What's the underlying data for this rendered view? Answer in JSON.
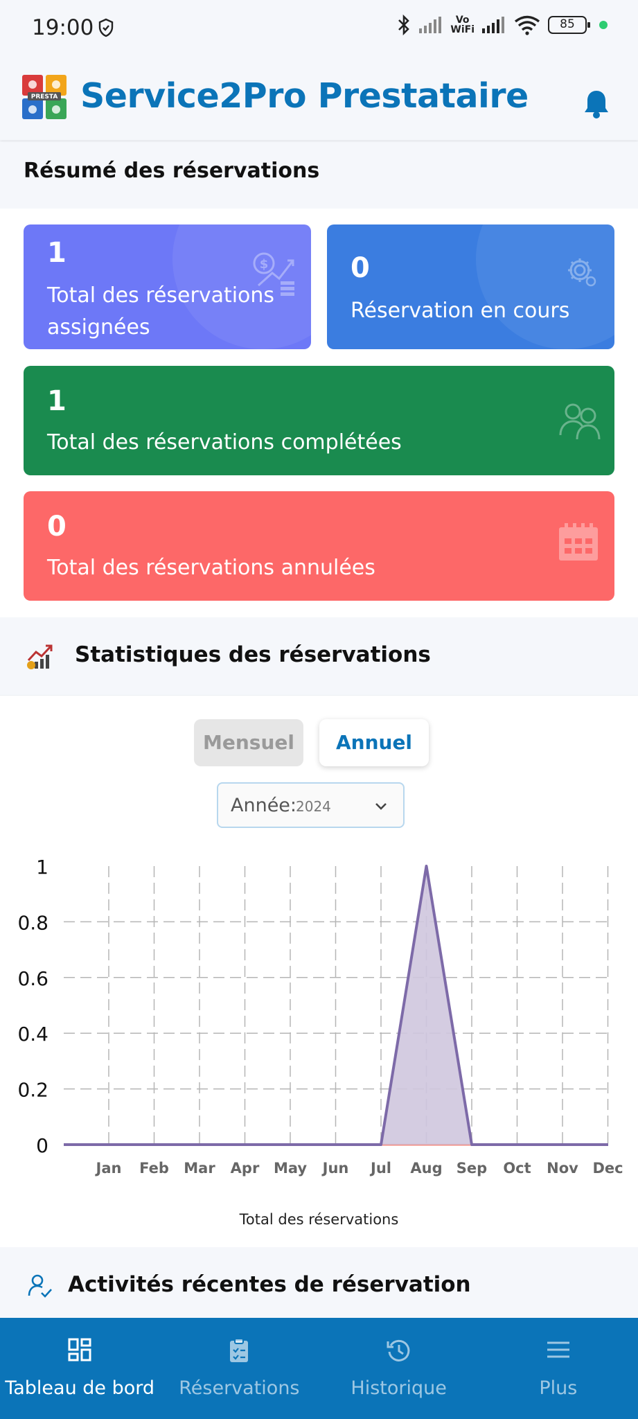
{
  "status_bar": {
    "time": "19:00",
    "vowifi_top": "Vo",
    "vowifi_bottom": "WiFi",
    "battery": "85"
  },
  "header": {
    "title": "Service2Pro Prestataire",
    "logo_text": "PRESTA"
  },
  "summary": {
    "title": "Résumé des réservations",
    "cards": [
      {
        "count": "1",
        "label": "Total des réservations assignées",
        "color": "#6d78f7",
        "icon": "money-growth-icon"
      },
      {
        "count": "0",
        "label": "Réservation en cours",
        "color": "#3b7de0",
        "icon": "gear-icon"
      },
      {
        "count": "1",
        "label": "Total des réservations complétées",
        "color": "#1a8b4f",
        "icon": "users-icon"
      },
      {
        "count": "0",
        "label": "Total des réservations annulées",
        "color": "#fd6868",
        "icon": "calendar-icon"
      }
    ]
  },
  "stats": {
    "title": "Statistiques des réservations",
    "toggle": {
      "monthly": "Mensuel",
      "annual": "Annuel",
      "selected": "annual"
    },
    "year_select": {
      "label": "Année:",
      "value": "2024"
    }
  },
  "chart_data": {
    "type": "area",
    "categories": [
      "Jan",
      "Feb",
      "Mar",
      "Apr",
      "May",
      "Jun",
      "Jul",
      "Aug",
      "Sep",
      "Oct",
      "Nov",
      "Dec"
    ],
    "series": [
      {
        "name": "Total des réservations",
        "values": [
          0,
          0,
          0,
          0,
          0,
          0,
          0,
          1,
          0,
          0,
          0,
          0
        ]
      }
    ],
    "yticks": [
      "0",
      "0.2",
      "0.4",
      "0.6",
      "0.8",
      "1"
    ],
    "ylim": [
      0,
      1
    ],
    "grid": true,
    "legend": "bottom-center",
    "colors": {
      "line": "#7d6aa8",
      "fill": "#cfc6de",
      "baseline": "#f08a80"
    }
  },
  "activity": {
    "title": "Activités récentes de réservation"
  },
  "nav": {
    "items": [
      {
        "label": "Tableau de bord",
        "icon": "dashboard-icon",
        "active": true
      },
      {
        "label": "Réservations",
        "icon": "clipboard-icon",
        "active": false
      },
      {
        "label": "Historique",
        "icon": "history-icon",
        "active": false
      },
      {
        "label": "Plus",
        "icon": "menu-icon",
        "active": false
      }
    ]
  }
}
